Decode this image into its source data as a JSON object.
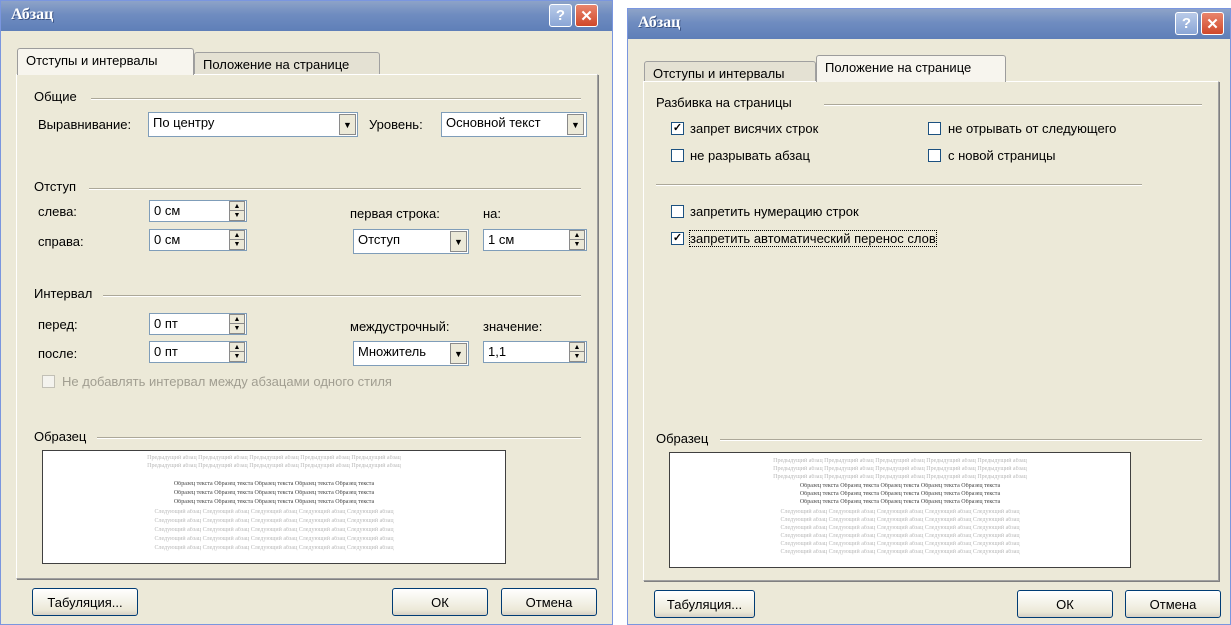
{
  "dialog1": {
    "title": "Абзац",
    "tabs": [
      "Отступы и интервалы",
      "Положение на странице"
    ],
    "general": {
      "section": "Общие",
      "alignment_label": "Выравнивание:",
      "alignment_value": "По центру",
      "level_label": "Уровень:",
      "level_value": "Основной текст"
    },
    "indent": {
      "section": "Отступ",
      "left_label": "слева:",
      "left_value": "0 см",
      "right_label": "справа:",
      "right_value": "0 см",
      "first_line_label": "первая строка:",
      "first_line_value": "Отступ",
      "by_label": "на:",
      "by_value": "1 см"
    },
    "spacing": {
      "section": "Интервал",
      "before_label": "перед:",
      "before_value": "0 пт",
      "after_label": "после:",
      "after_value": "0 пт",
      "line_label": "междустрочный:",
      "line_value": "Множитель",
      "at_label": "значение:",
      "at_value": "1,1",
      "no_space_label": "Не добавлять интервал между абзацами одного стиля"
    },
    "preview_section": "Образец",
    "tabs_button": "Табуляция...",
    "ok_button": "ОК",
    "cancel_button": "Отмена"
  },
  "dialog2": {
    "title": "Абзац",
    "tabs": [
      "Отступы и интервалы",
      "Положение на странице"
    ],
    "pagination_section": "Разбивка на страницы",
    "widow_control": "запрет висячих строк",
    "keep_with_next": "не отрывать от следующего",
    "keep_lines": "не разрывать абзац",
    "page_break_before": "с новой страницы",
    "suppress_line_numbers": "запретить нумерацию строк",
    "no_hyphenation": "запретить автоматический перенос слов",
    "checked": {
      "widow_control": true,
      "keep_with_next": false,
      "keep_lines": false,
      "page_break_before": false,
      "suppress_line_numbers": false,
      "no_hyphenation": true
    },
    "preview_section": "Образец",
    "tabs_button": "Табуляция...",
    "ok_button": "ОК",
    "cancel_button": "Отмена"
  },
  "preview_text": {
    "prev": "Предыдущий абзац Предыдущий абзац Предыдущий абзац Предыдущий абзац Предыдущий абзац",
    "sample": "Образец текста Образец текста Образец текста Образец текста Образец текста",
    "next": "Следующий абзац Следующий абзац Следующий абзац Следующий абзац Следующий абзац"
  },
  "colors": {
    "title_bar": "#7590c4",
    "dialog_bg": "#ece9d8",
    "close_button": "#d0482a"
  }
}
